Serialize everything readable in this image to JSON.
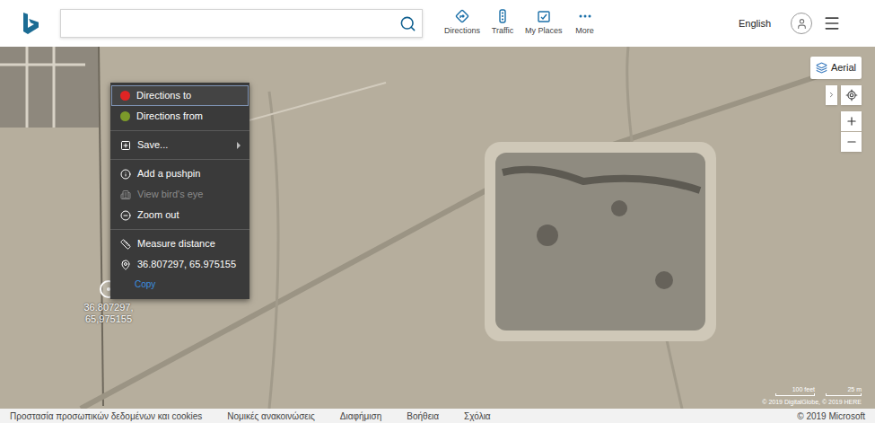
{
  "header": {
    "nav": [
      {
        "label": "Directions"
      },
      {
        "label": "Traffic"
      },
      {
        "label": "My Places"
      },
      {
        "label": "More"
      }
    ],
    "language": "English"
  },
  "map": {
    "view_button": "Aerial",
    "pin": {
      "label_lines": [
        "36.807297,",
        "65,975155"
      ]
    },
    "scale": {
      "imperial": "100 feet",
      "metric": "25 m"
    },
    "attribution": "© 2019 DigitalGlobe, © 2019 HERE"
  },
  "context_menu": {
    "items": [
      {
        "kind": "item",
        "label": "Directions to",
        "selected": true,
        "disabled": false,
        "color": "#e02424"
      },
      {
        "kind": "item",
        "label": "Directions from",
        "selected": false,
        "disabled": false,
        "color": "#7c9a2a"
      },
      {
        "kind": "separator"
      },
      {
        "kind": "submenu",
        "label": "Save...",
        "selected": false,
        "disabled": false
      },
      {
        "kind": "separator"
      },
      {
        "kind": "item",
        "label": "Add a pushpin",
        "selected": false,
        "disabled": false
      },
      {
        "kind": "item",
        "label": "View bird's eye",
        "selected": false,
        "disabled": true
      },
      {
        "kind": "item",
        "label": "Zoom out",
        "selected": false,
        "disabled": false
      },
      {
        "kind": "separator"
      },
      {
        "kind": "item",
        "label": "Measure distance",
        "selected": false,
        "disabled": false
      },
      {
        "kind": "coords",
        "label": "36.807297, 65.975155",
        "action": "Copy",
        "selected": false,
        "disabled": false
      }
    ]
  },
  "footer": {
    "links": [
      "Προστασία προσωπικών δεδομένων και cookies",
      "Νομικές ανακοινώσεις",
      "Διαφήμιση",
      "Βοήθεια",
      "Σχόλια"
    ],
    "copyright": "© 2019 Microsoft"
  }
}
